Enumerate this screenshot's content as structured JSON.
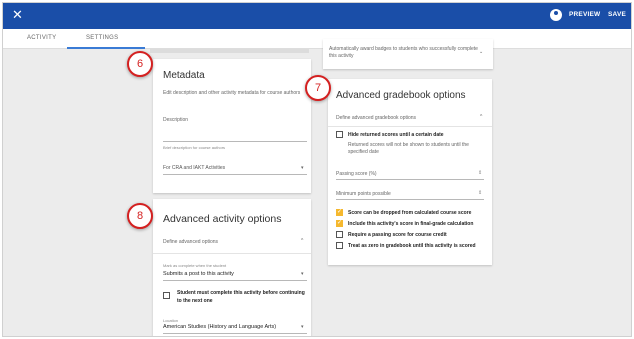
{
  "topbar": {
    "close_icon": "close-icon",
    "preview_label": "PREVIEW",
    "save_label": "SAVE",
    "avatar_icon": "account-icon",
    "bar_color": "#1a4ea8"
  },
  "tabs": [
    {
      "label": "ACTIVITY"
    },
    {
      "label": "SETTINGS",
      "active": true
    }
  ],
  "metadata": {
    "title": "Metadata",
    "description_text": "Edit description and other activity metadata for course authors",
    "description_label": "Description",
    "description_hint": "Brief description for course authors",
    "audience_value": "For CRA and IAKT Activities"
  },
  "advanced_activity": {
    "title": "Advanced activity options",
    "section_label": "Define advanced options",
    "complete_label": "Mark as complete when the student",
    "complete_value": "Submits a post to this activity",
    "prereq_label": "Student must complete this activity before continuing to the next one",
    "location_label": "Location",
    "location_value": "American Studies (History and Language Arts)"
  },
  "badges": {
    "text": "Automatically award badges to students who successfully complete this activity"
  },
  "gradebook": {
    "title": "Advanced gradebook options",
    "section_label": "Define advanced gradebook options",
    "hide_label": "Hide returned scores until a certain date",
    "hide_desc": "Returned scores will not be shown to students until the specified date",
    "passing_label": "Passing score (%)",
    "minimum_label": "Minimum points possible",
    "checkboxes": [
      {
        "label": "Score can be dropped from calculated course score",
        "checked": true
      },
      {
        "label": "Include this activity's score in final-grade calculation",
        "checked": true
      },
      {
        "label": "Require a passing score for course credit",
        "checked": false
      },
      {
        "label": "Treat as zero in gradebook until this activity is scored",
        "checked": false
      }
    ]
  },
  "markers": [
    "6",
    "7",
    "8"
  ],
  "colors": {
    "accent": "#3a7bd5",
    "checkbox_checked": "#f5b82e",
    "marker": "#d42020"
  }
}
